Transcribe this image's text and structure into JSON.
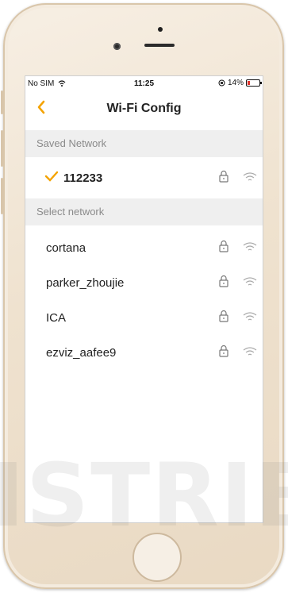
{
  "status_bar": {
    "carrier": "No SIM",
    "time": "11:25",
    "battery": "14%"
  },
  "nav": {
    "title": "Wi-Fi Config",
    "back_icon": "chevron-left-icon"
  },
  "sections": {
    "saved": "Saved Network",
    "select": "Select network"
  },
  "saved_network": {
    "name": "112233"
  },
  "networks": [
    {
      "name": "cortana"
    },
    {
      "name": "parker_zhoujie"
    },
    {
      "name": "ICA"
    },
    {
      "name": "ezviz_aafee9"
    }
  ],
  "watermark": "ISTRIB",
  "colors": {
    "accent": "#f4a300"
  }
}
